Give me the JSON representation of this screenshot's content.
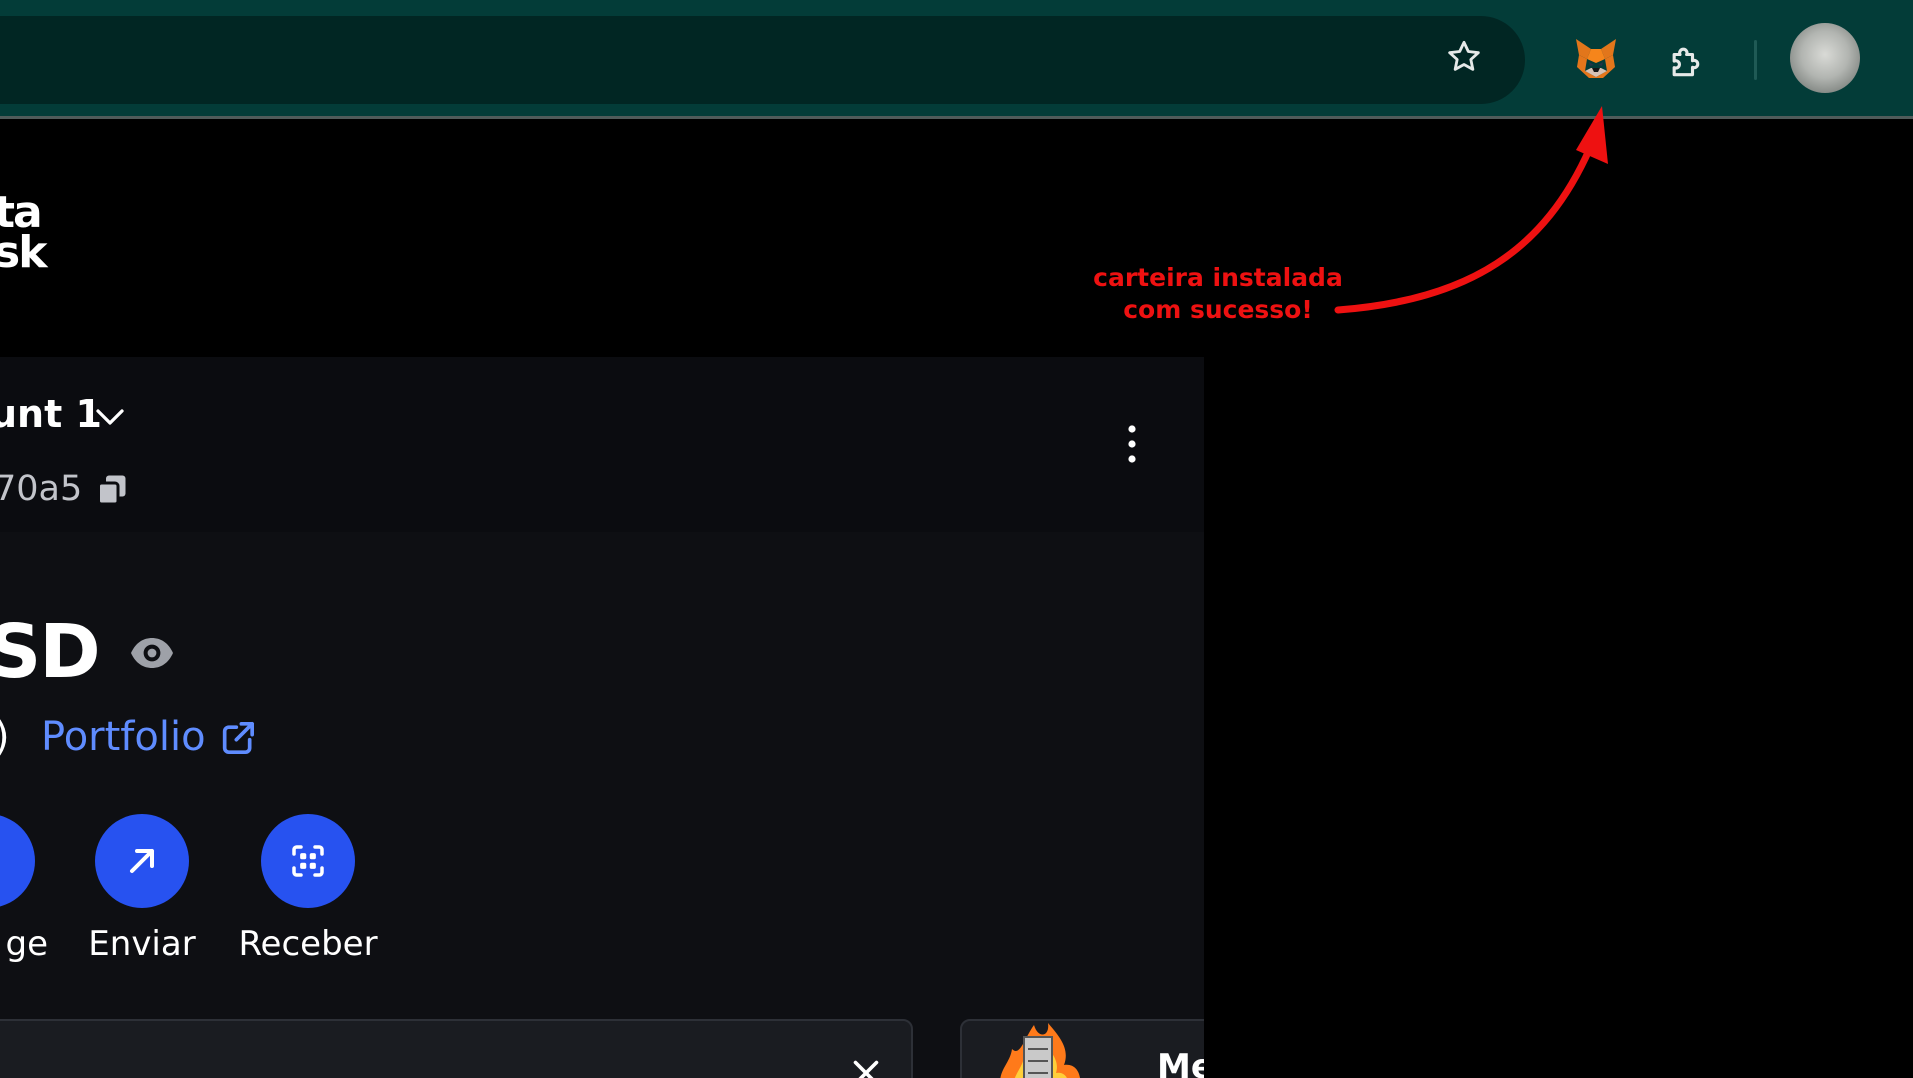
{
  "browser": {
    "extension_name": "MetaMask",
    "icons": {
      "bookmark": "star-outline-icon",
      "extension": "metamask-fox-icon",
      "extensions_menu": "puzzle-piece-icon",
      "profile": "profile-avatar"
    },
    "colors": {
      "toolbar": "#033c38",
      "omnibox": "#012623"
    }
  },
  "annotation": {
    "text_line1": "carteira instalada",
    "text_line2": "com sucesso!",
    "color": "#ee1111"
  },
  "logo": {
    "line1": "ta",
    "line2": "sk"
  },
  "account": {
    "name": "unt 1",
    "address": "70a5"
  },
  "balance": {
    "value": "SD",
    "sub": ")",
    "portfolio_label": "Portfolio"
  },
  "actions": [
    {
      "label": "ge"
    },
    {
      "label": "Enviar"
    },
    {
      "label": "Receber"
    }
  ],
  "cards": {
    "right_title": "Me"
  },
  "colors": {
    "accent": "#2752f0",
    "link": "#5f8cff",
    "panel": "#0e0f13"
  }
}
